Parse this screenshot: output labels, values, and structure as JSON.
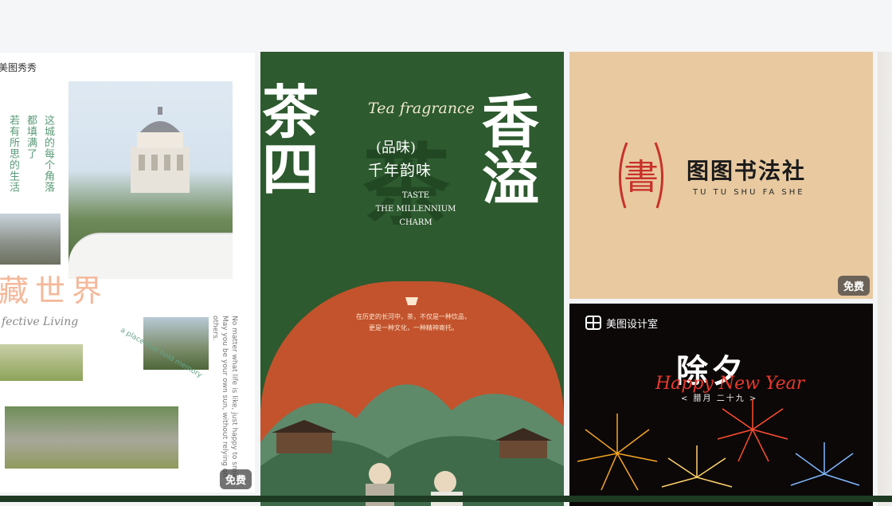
{
  "cards": [
    {
      "brand": "美图秀秀",
      "vertical_lines": [
        "这城的每个角落",
        "都填满了",
        "若有所思的生活"
      ],
      "headline": "藏世界",
      "script": "fective Living",
      "circle_text": "a place that hold memory",
      "side_text": "No matter what life is like, just happy to smile. May you be your own sun, without relying on others.",
      "badge": "免费"
    },
    {
      "left_big": "茶四",
      "right_big": "香溢",
      "fragrance": "Tea fragrance",
      "ghost": "茶",
      "pinwei": "(品味)",
      "qiannian": "千年韵味",
      "english": [
        "TASTE",
        "THE MILLENNIUM",
        "CHARM"
      ],
      "arch_text": [
        "在历史的长河中，茶，不仅是一种饮品，",
        "更是一种文化，一种精神寄托。"
      ],
      "colors": {
        "background": "#2d5a2f",
        "arch": "#c3532d"
      }
    },
    {
      "seal_char": "書",
      "name": "图图书法社",
      "pinyin": "TU TU SHU FA SHE",
      "badge": "免费",
      "colors": {
        "background": "#e8c9a0",
        "seal": "#c8312a"
      }
    },
    {
      "brand": "美图设计室",
      "title": "除夕",
      "script": "Happy New Year",
      "date": "< 腊月 二十九 >",
      "icon": "meitu-design-logo-icon"
    }
  ]
}
